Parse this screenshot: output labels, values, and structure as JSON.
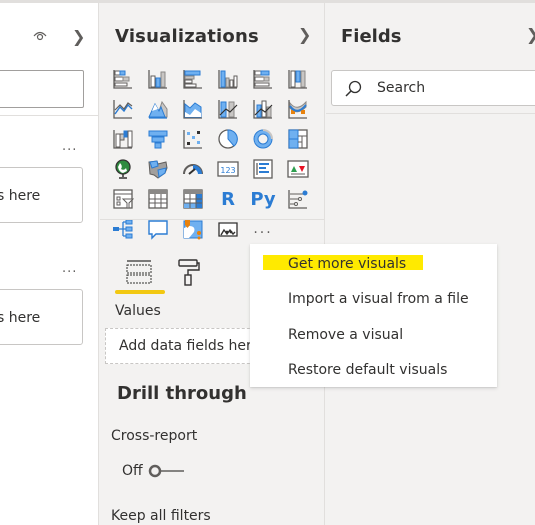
{
  "filters_panel": {
    "eye_icon": "eye-icon",
    "collapse_icon": "chevron-right-icon",
    "cards": [
      {
        "more_label": "...",
        "drop_text": "Add data fields here"
      },
      {
        "more_label": "...",
        "drop_text": "Add data fields here"
      }
    ],
    "drop_visible_text": "s here"
  },
  "visualizations": {
    "title": "Visualizations",
    "collapse_icon": "chevron-right-icon",
    "icons": [
      "stacked-bar-chart-icon",
      "stacked-column-chart-icon",
      "clustered-bar-chart-icon",
      "clustered-column-chart-icon",
      "100-stacked-bar-chart-icon",
      "100-stacked-column-chart-icon",
      "line-chart-icon",
      "area-chart-icon",
      "stacked-area-chart-icon",
      "line-and-stacked-column-icon",
      "line-and-clustered-column-icon",
      "ribbon-chart-icon",
      "waterfall-chart-icon",
      "funnel-icon",
      "scatter-chart-icon",
      "pie-chart-icon",
      "donut-chart-icon",
      "treemap-icon",
      "map-icon",
      "filled-map-icon",
      "gauge-icon",
      "card-icon",
      "multi-row-card-icon",
      "kpi-icon",
      "slicer-icon",
      "table-icon",
      "matrix-icon",
      "r-script-visual-icon",
      "python-visual-icon",
      "key-influencers-icon",
      "decomposition-tree-icon",
      "qa-icon",
      "smart-narrative-icon",
      "paginated-report-icon",
      "more-options-icon"
    ],
    "r_label": "R",
    "py_label": "Py",
    "card_label": "123",
    "more_label": "...",
    "tabs": [
      {
        "name": "fields",
        "icon": "fields-well-icon",
        "active": true
      },
      {
        "name": "format",
        "icon": "paint-roller-icon",
        "active": false
      }
    ],
    "values_label": "Values",
    "add_fields_placeholder": "Add data fields here",
    "drill_through": {
      "title": "Drill through",
      "cross_report_label": "Cross-report",
      "toggle_state_label": "Off",
      "toggle_on": false,
      "keep_filters_label": "Keep all filters"
    }
  },
  "fields": {
    "title": "Fields",
    "collapse_icon": "chevron-right-icon",
    "search_placeholder": "Search"
  },
  "context_menu": {
    "items": [
      {
        "label": "Get more visuals",
        "highlighted": true
      },
      {
        "label": "Import a visual from a file",
        "highlighted": false
      },
      {
        "label": "Remove a visual",
        "highlighted": false
      },
      {
        "label": "Restore default visuals",
        "highlighted": false
      }
    ],
    "highlight_color": "#ffea00"
  },
  "colors": {
    "accent_blue": "#2b7cd3",
    "light_blue": "#6fb0f0",
    "gray_icon": "#605e5c",
    "tab_underline": "#f2c811",
    "panel_bg": "#f3f2f1"
  }
}
